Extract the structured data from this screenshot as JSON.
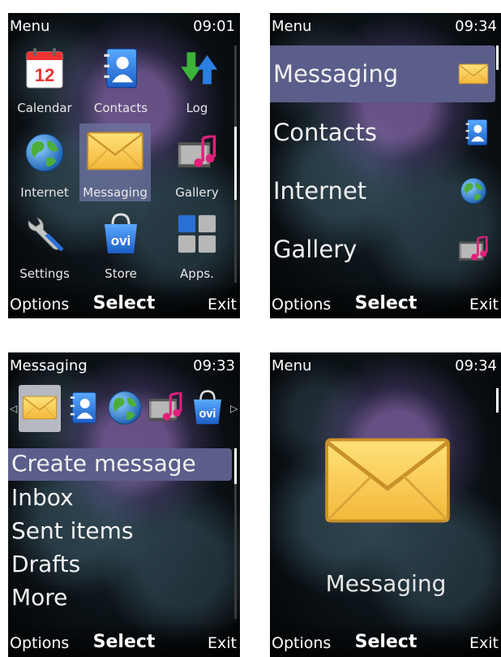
{
  "colors": {
    "selection": "#5b5e8a",
    "grid_selection": "#6e73a0",
    "text": "#ffffff"
  },
  "screen1": {
    "title": "Menu",
    "time": "09:01",
    "items": [
      {
        "label": "Calendar",
        "icon": "calendar-icon",
        "badge": "12"
      },
      {
        "label": "Contacts",
        "icon": "contacts-icon"
      },
      {
        "label": "Log",
        "icon": "log-icon"
      },
      {
        "label": "Internet",
        "icon": "globe-icon"
      },
      {
        "label": "Messaging",
        "icon": "envelope-icon",
        "selected": true
      },
      {
        "label": "Gallery",
        "icon": "gallery-icon"
      },
      {
        "label": "Settings",
        "icon": "wrench-icon"
      },
      {
        "label": "Store",
        "icon": "ovi-store-icon",
        "badge": "ovi"
      },
      {
        "label": "Apps.",
        "icon": "apps-icon"
      }
    ],
    "softkeys": {
      "left": "Options",
      "center": "Select",
      "right": "Exit"
    }
  },
  "screen2": {
    "title": "Menu",
    "time": "09:34",
    "items": [
      {
        "label": "Messaging",
        "icon": "envelope-icon",
        "selected": true
      },
      {
        "label": "Contacts",
        "icon": "contacts-icon"
      },
      {
        "label": "Internet",
        "icon": "globe-icon"
      },
      {
        "label": "Gallery",
        "icon": "gallery-icon"
      }
    ],
    "softkeys": {
      "left": "Options",
      "center": "Select",
      "right": "Exit"
    }
  },
  "screen3": {
    "title": "Messaging",
    "time": "09:33",
    "carousel": [
      "envelope-icon",
      "contacts-icon",
      "globe-icon",
      "gallery-icon",
      "ovi-store-icon"
    ],
    "carousel_badge": "ovi",
    "items": [
      {
        "label": "Create message",
        "selected": true
      },
      {
        "label": "Inbox"
      },
      {
        "label": "Sent items"
      },
      {
        "label": "Drafts"
      },
      {
        "label": "More"
      }
    ],
    "softkeys": {
      "left": "Options",
      "center": "Select",
      "right": "Exit"
    }
  },
  "screen4": {
    "title": "Menu",
    "time": "09:34",
    "icon": "envelope-icon",
    "label": "Messaging",
    "softkeys": {
      "left": "Options",
      "center": "Select",
      "right": "Exit"
    }
  }
}
